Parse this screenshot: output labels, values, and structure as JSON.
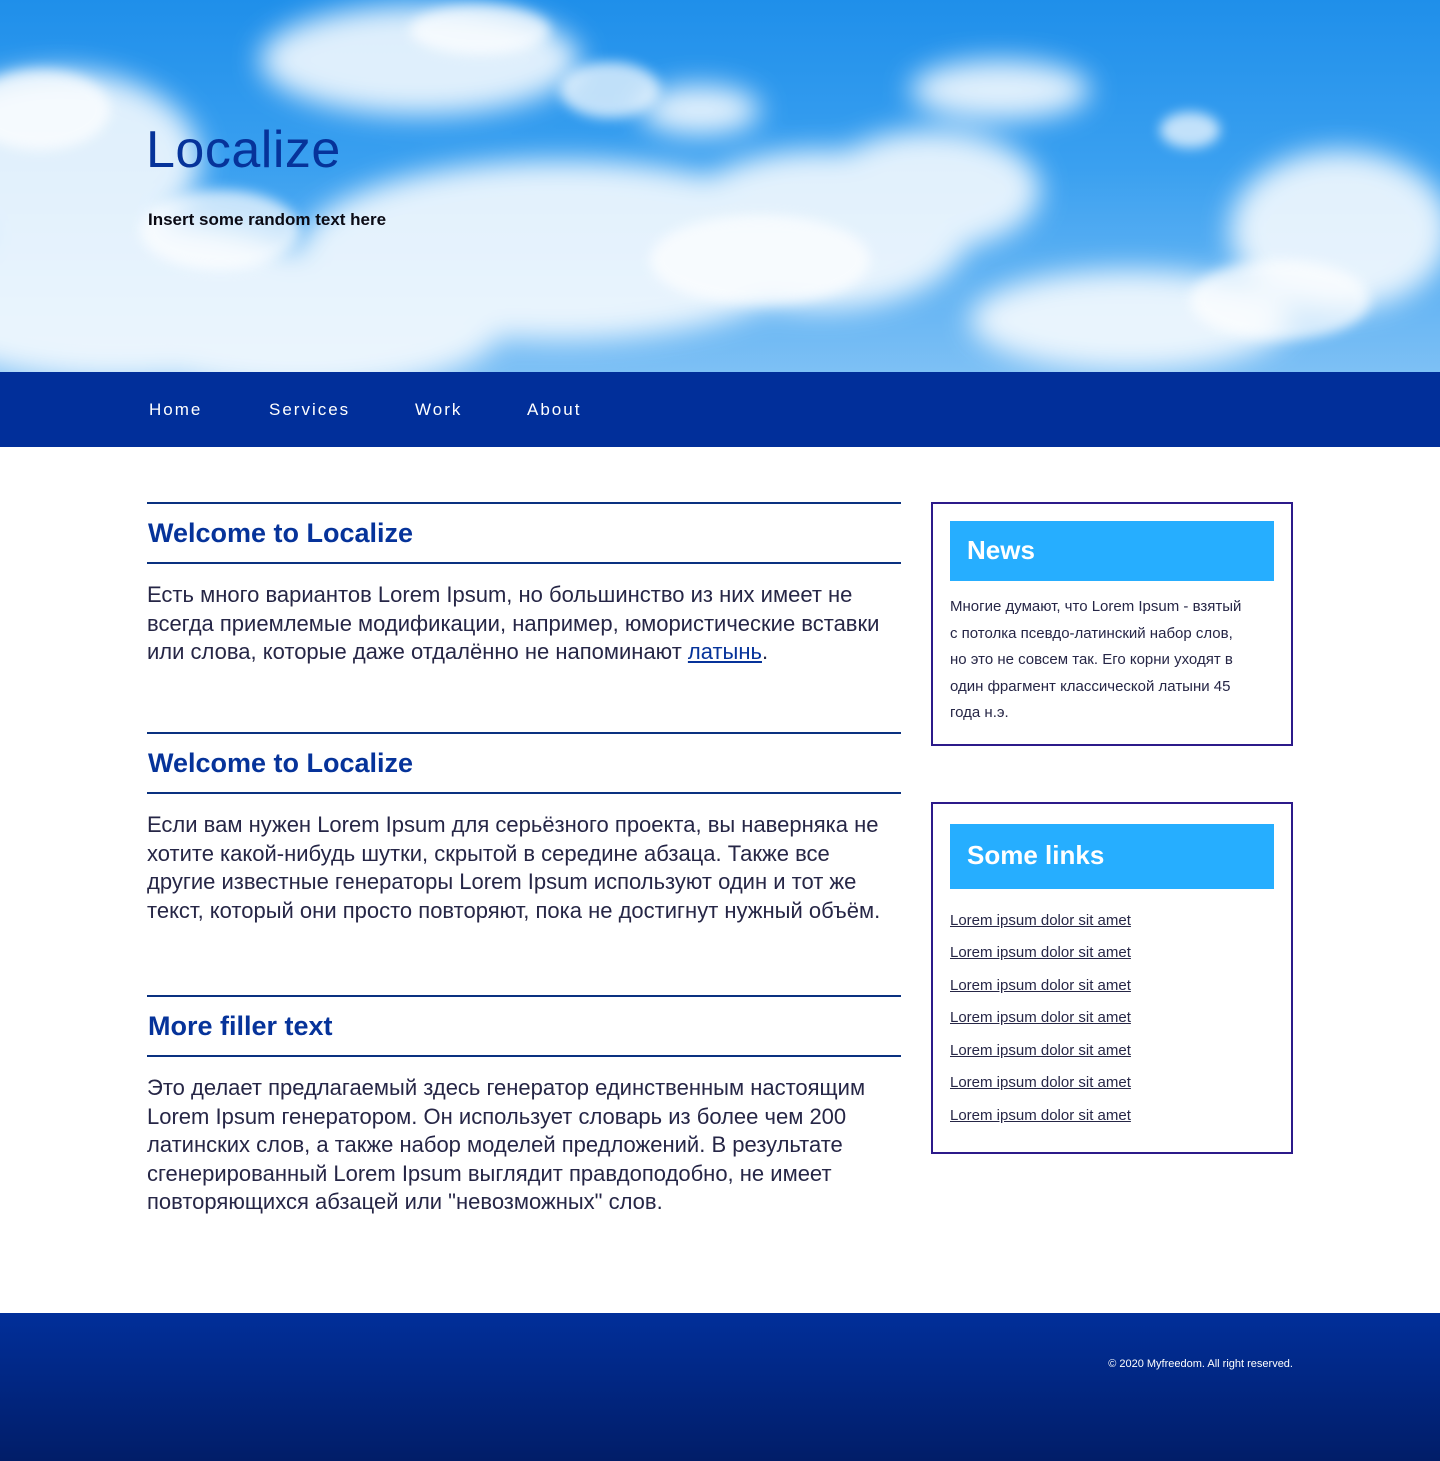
{
  "hero": {
    "title": "Localize",
    "subtitle": "Insert some random text here"
  },
  "nav": {
    "items": [
      {
        "label": "Home"
      },
      {
        "label": "Services"
      },
      {
        "label": "Work"
      },
      {
        "label": "About"
      }
    ]
  },
  "main": {
    "sections": [
      {
        "heading": "Welcome to Localize",
        "text": "Есть много вариантов Lorem Ipsum, но большинство из них имеет не всегда приемлемые модификации, например, юмористические вставки или слова, которые даже отдалённо не напоминают ",
        "link": "латынь",
        "after_link": "."
      },
      {
        "heading": "Welcome to Localize",
        "text": "Если вам нужен Lorem Ipsum для серьёзного проекта, вы наверняка не хотите какой-нибудь шутки, скрытой в середине абзаца. Также все другие известные генераторы Lorem Ipsum используют один и тот же текст, который они просто повторяют, пока не достигнут нужный объём."
      },
      {
        "heading": "More filler text",
        "text": "Это делает предлагаемый здесь генератор единственным настоящим Lorem Ipsum генератором. Он использует словарь из более чем 200 латинских слов, а также набор моделей предложений. В результате сгенерированный Lorem Ipsum выглядит правдоподобно, не имеет повторяющихся абзацей или \"невозможных\" слов."
      }
    ]
  },
  "sidebar": {
    "news": {
      "title": "News",
      "text": "Многие думают, что Lorem Ipsum - взятый с потолка псевдо-латинский набор слов, но это не совсем так. Его корни уходят в один фрагмент классической латыни 45 года н.э."
    },
    "links": {
      "title": "Some links",
      "items": [
        "Lorem ipsum dolor sit amet",
        "Lorem ipsum dolor sit amet",
        "Lorem ipsum dolor sit amet",
        "Lorem ipsum dolor sit amet",
        "Lorem ipsum dolor sit amet",
        "Lorem ipsum dolor sit amet",
        "Lorem ipsum dolor sit amet"
      ]
    }
  },
  "footer": {
    "copyright": "© 2020 Myfreedom. All right reserved."
  },
  "colors": {
    "primary": "#012f9a",
    "heading": "#06339a",
    "accent": "#26aeff",
    "box_border": "#2c1a8a",
    "text": "#262646"
  }
}
